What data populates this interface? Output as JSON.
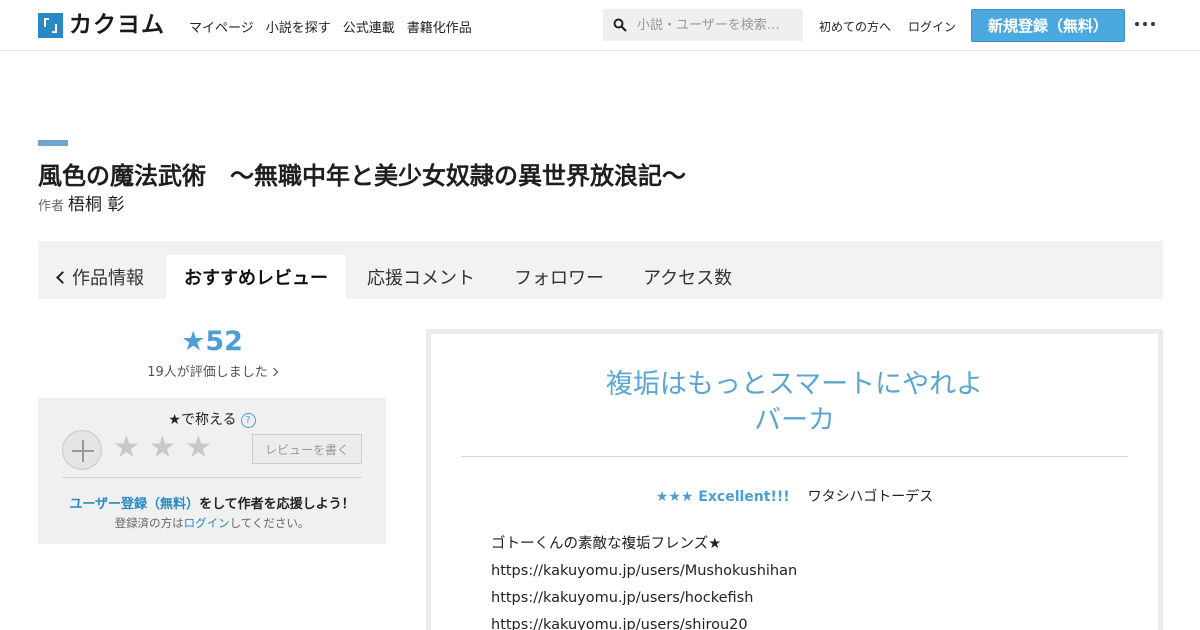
{
  "header": {
    "logo_text": "カクヨム",
    "nav": [
      "マイページ",
      "小説を探す",
      "公式連載",
      "書籍化作品"
    ],
    "search_placeholder": "小説・ユーザーを検索…",
    "first_time": "初めての方へ",
    "login": "ログイン",
    "signup": "新規登録（無料）"
  },
  "work": {
    "title": "風色の魔法武術　～無職中年と美少女奴隷の異世界放浪記～",
    "author_label": "作者",
    "author_name": "梧桐 彰"
  },
  "tabs": {
    "info": "作品情報",
    "reviews": "おすすめレビュー",
    "comments": "応援コメント",
    "followers": "フォロワー",
    "access": "アクセス数"
  },
  "rating": {
    "stars": "★52",
    "rated_by": "19人が評価しました"
  },
  "praise": {
    "title": "★で称える",
    "help": "?",
    "star_glyph": "★",
    "write_review": "レビューを書く",
    "support_link": "ユーザー登録（無料）",
    "support_text": "をして作者を応援しよう！",
    "login_prefix": "登録済の方は",
    "login_link": "ログイン",
    "login_suffix": "してください。"
  },
  "review": {
    "title_line1": "複垢はもっとスマートにやれよ",
    "title_line2": "バーカ",
    "rating": "★★★ Excellent!!!",
    "reviewer": "ワタシハゴトーデス",
    "body": [
      "ゴトーくんの素敵な複垢フレンズ★",
      "https://kakuyomu.jp/users/Mushokushihan",
      "https://kakuyomu.jp/users/hockefish",
      "https://kakuyomu.jp/users/shirou20"
    ]
  },
  "colors": {
    "accent_blue": "#4a9fd5",
    "signup_bg": "#4aaadf",
    "logo_blue": "#2a89c4"
  }
}
